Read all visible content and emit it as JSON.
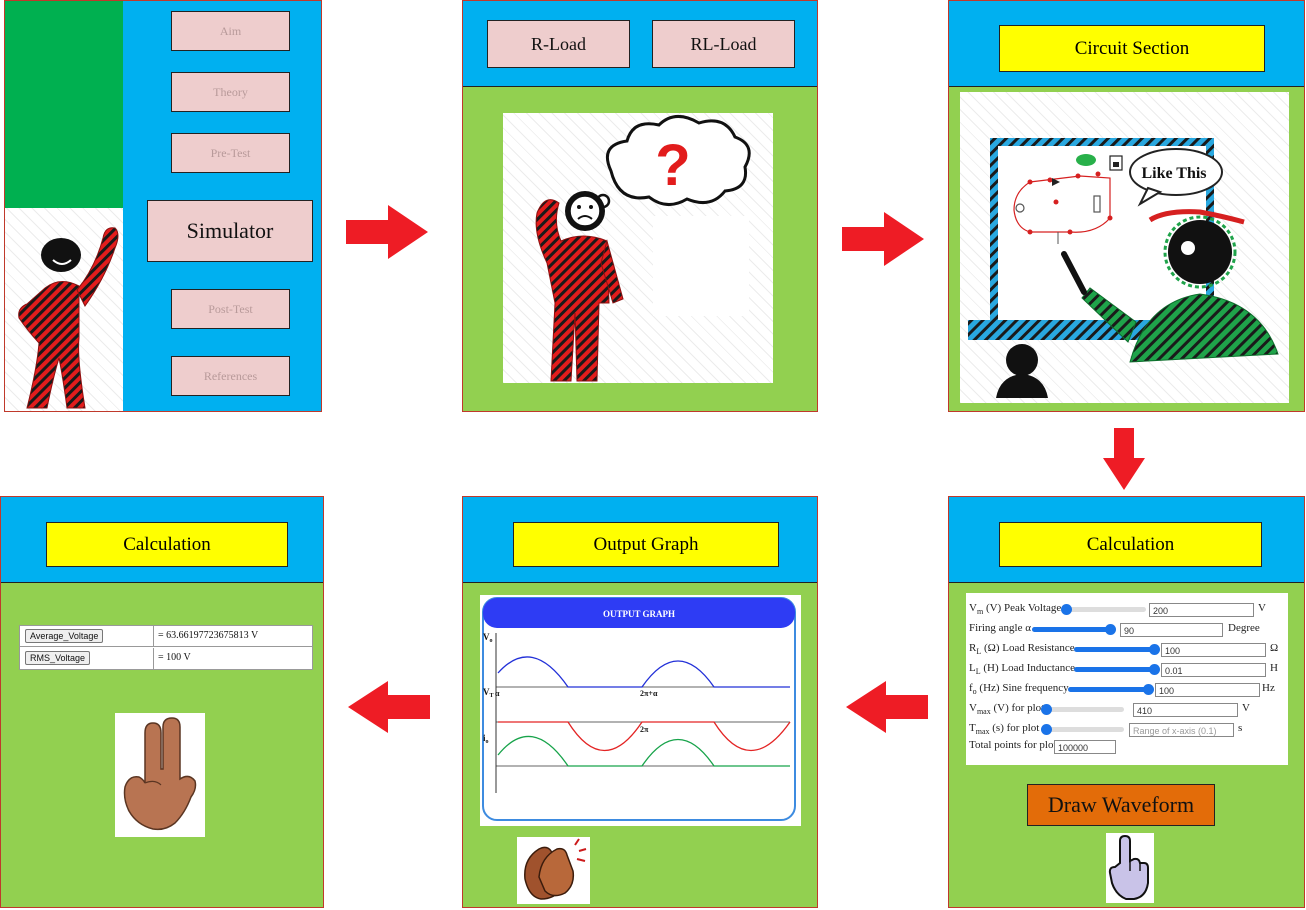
{
  "menu": {
    "aim": "Aim",
    "theory": "Theory",
    "pretest": "Pre-Test",
    "simulator": "Simulator",
    "posttest": "Post-Test",
    "references": "References"
  },
  "load": {
    "r_load": "R-Load",
    "rl_load": "RL-Load"
  },
  "question_mark": "?",
  "circuit": {
    "title": "Circuit Section",
    "bubble": "Like This"
  },
  "calc_inputs": {
    "title": "Calculation",
    "params": [
      {
        "sym": "V",
        "sub": "m",
        "label": " (V) Peak Voltage",
        "value": "200",
        "unit": "V",
        "fraction": 0.0
      },
      {
        "sym": "",
        "sub": "",
        "label": "Firing angle α",
        "value": "90",
        "unit": "Degree",
        "fraction": 1.0
      },
      {
        "sym": "R",
        "sub": "L",
        "label": " (Ω) Load Resistance",
        "value": "100",
        "unit": "Ω",
        "fraction": 1.0
      },
      {
        "sym": "L",
        "sub": "L",
        "label": " (H) Load Inductance",
        "value": "0.01",
        "unit": "H",
        "fraction": 1.0
      },
      {
        "sym": "f",
        "sub": "o",
        "label": " (Hz) Sine frequency",
        "value": "100",
        "unit": "Hz",
        "fraction": 1.0
      },
      {
        "sym": "V",
        "sub": "max",
        "label": " (V) for plot",
        "value": "410",
        "unit": "V",
        "fraction": 0.0
      },
      {
        "sym": "T",
        "sub": "max",
        "label": " (s) for plot",
        "value": "",
        "placeholder": "Range of x-axis (0.1)",
        "unit": "s",
        "fraction": 0.0
      },
      {
        "sym": "",
        "sub": "",
        "label": "Total points for plot",
        "value": "100000",
        "unit": "",
        "fraction": null
      }
    ],
    "draw_button": "Draw Waveform"
  },
  "graph": {
    "title": "Output Graph",
    "header": "OUTPUT GRAPH",
    "vo": "V",
    "vo_sub": "o",
    "vt": "V",
    "vt_sub": "T",
    "io": "i",
    "io_sub": "o",
    "alpha": "α",
    "two_pi_alpha": "2π+α",
    "two_pi": "2π"
  },
  "calc_results": {
    "title": "Calculation",
    "rows": [
      {
        "label": "Average_Voltage",
        "value": "= 63.66197723675813 V"
      },
      {
        "label": "RMS_Voltage",
        "value": "= 100 V"
      }
    ]
  },
  "colors": {
    "blue": "#00b0f0",
    "green": "#92d050",
    "dark_green": "#00b050",
    "yellow": "#ffff00",
    "pink": "#eecdcd",
    "arrow_red": "#ee1c25",
    "figure_red": "#e21c1c",
    "draw_button": "#e36c09"
  },
  "icons": [
    "thinking-person-icon",
    "pointing-teacher-icon",
    "pointer-hand-icon",
    "clapping-hands-icon",
    "two-finger-hand-icon",
    "question-cloud-icon"
  ]
}
